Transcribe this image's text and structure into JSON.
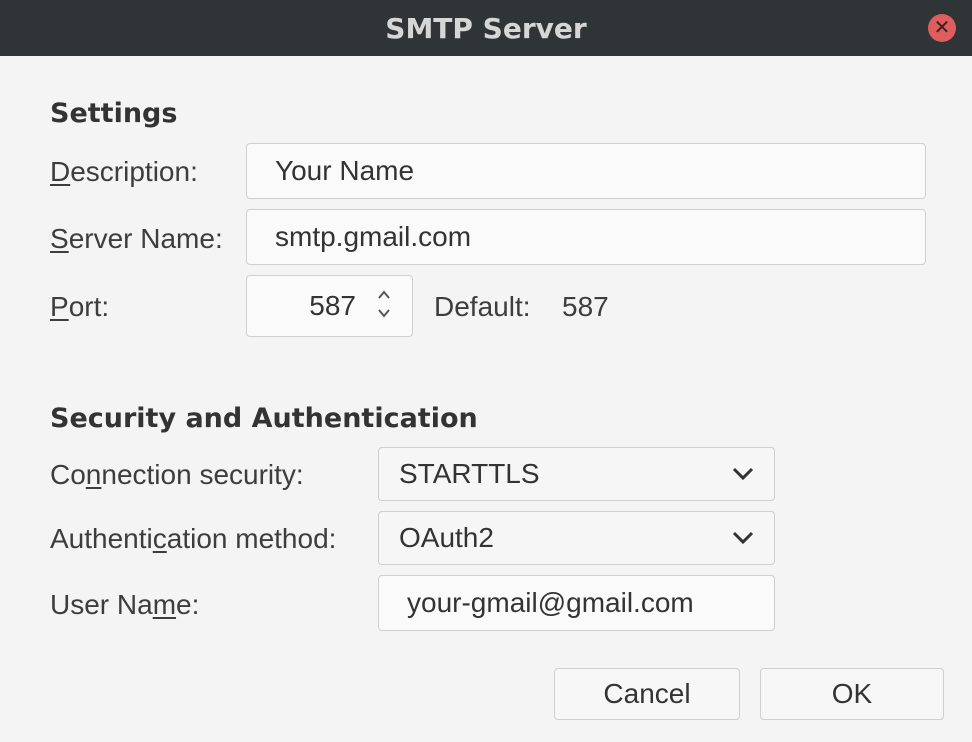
{
  "window": {
    "title": "SMTP Server"
  },
  "settings": {
    "header": "Settings",
    "description_label": "Description:",
    "description_value": "Your Name",
    "server_label": "Server Name:",
    "server_value": "smtp.gmail.com",
    "port_label": "Port:",
    "port_value": "587",
    "default_label": "Default:",
    "default_value": "587"
  },
  "security": {
    "header": "Security and Authentication",
    "connection_label": "Connection security:",
    "connection_value": "STARTTLS",
    "auth_label": "Authentication method:",
    "auth_value": "OAuth2",
    "username_label": "User Name:",
    "username_value": "your-gmail@gmail.com"
  },
  "buttons": {
    "cancel": "Cancel",
    "ok": "OK"
  },
  "icons": {
    "close": "close-icon",
    "spinner": "spinner-arrows-icon",
    "dropdown": "chevron-down-icon"
  },
  "colors": {
    "titlebar": "#2f3436",
    "close": "#e05d5d",
    "background": "#f4f4f4"
  }
}
